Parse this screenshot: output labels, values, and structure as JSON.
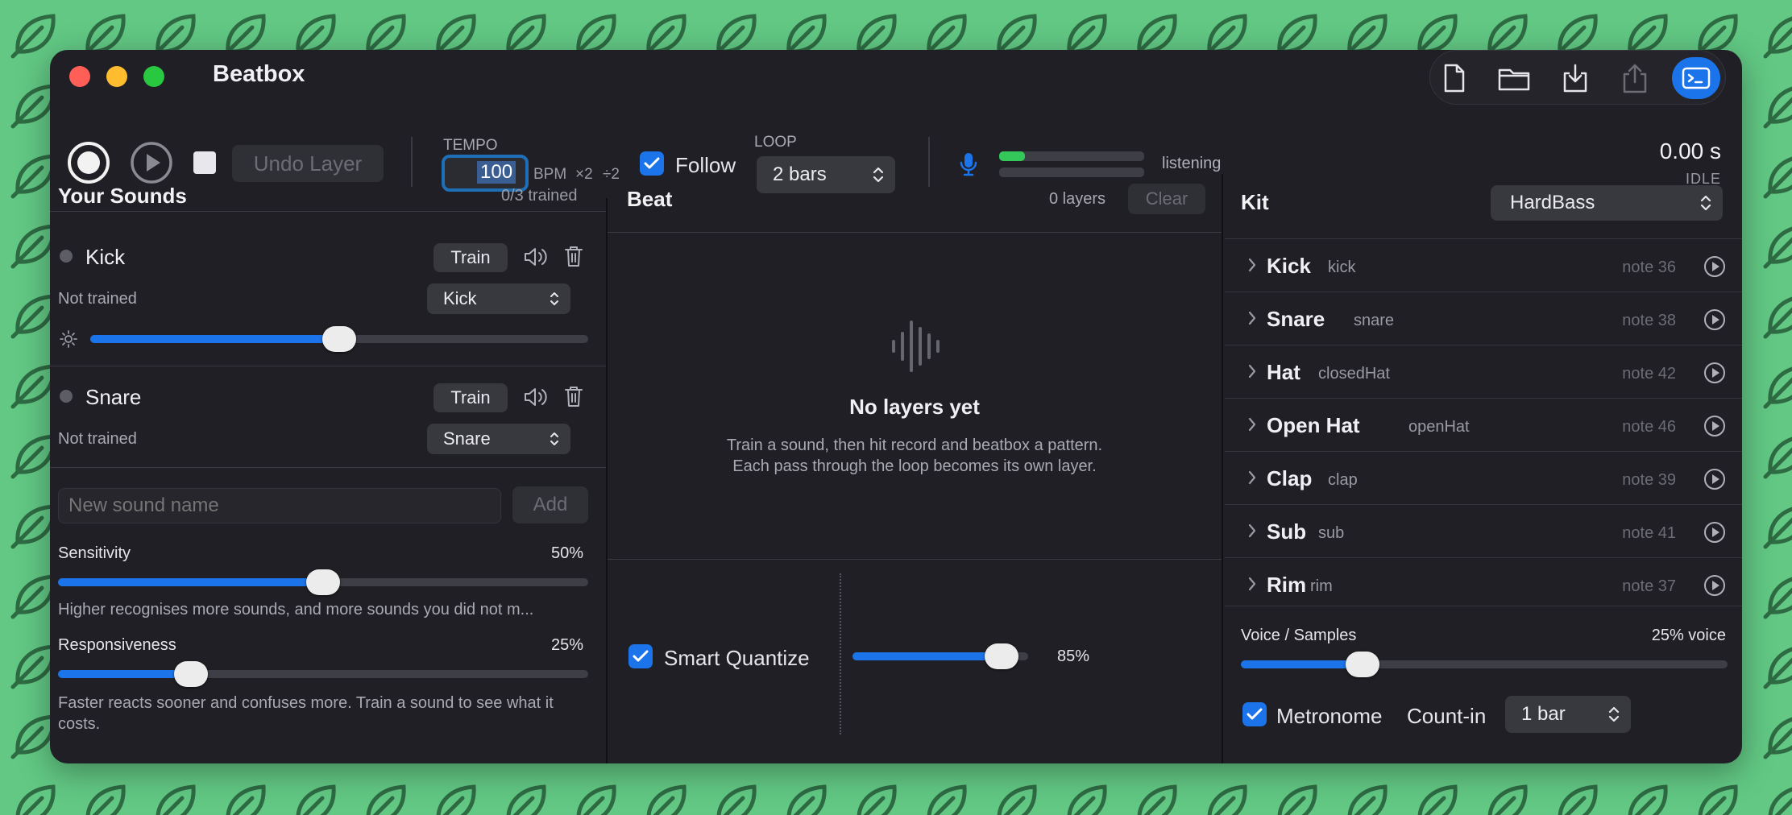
{
  "app": {
    "title": "Beatbox"
  },
  "transport": {
    "undo_label": "Undo Layer"
  },
  "tempo": {
    "label": "TEMPO",
    "bpm": "100",
    "unit": "BPM",
    "double": "×2",
    "half": "÷2",
    "trained": "0/3 trained"
  },
  "follow": {
    "label": "Follow"
  },
  "loop": {
    "label": "LOOP",
    "value": "2 bars"
  },
  "mic": {
    "level_percent": 18,
    "status": "listening"
  },
  "timer": {
    "value": "0.00 s",
    "state": "IDLE"
  },
  "sounds": {
    "header": "Your Sounds",
    "items": [
      {
        "name": "Kick",
        "train_label": "Train",
        "status": "Not trained",
        "mapping": "Kick",
        "threshold_percent": 50
      },
      {
        "name": "Snare",
        "train_label": "Train",
        "status": "Not trained",
        "mapping": "Snare"
      }
    ],
    "new_placeholder": "New sound name",
    "add_label": "Add",
    "sensitivity": {
      "label": "Sensitivity",
      "value": "50%",
      "percent": 50,
      "help": "Higher recognises more sounds, and more sounds you did not m..."
    },
    "responsiveness": {
      "label": "Responsiveness",
      "value": "25%",
      "percent": 25,
      "help": "Faster reacts sooner and confuses more. Train a sound to see what it costs."
    }
  },
  "beat": {
    "header": "Beat",
    "count": "0 layers",
    "clear_label": "Clear",
    "empty_title": "No layers yet",
    "empty_line1": "Train a sound, then hit record and beatbox a pattern.",
    "empty_line2": "Each pass through the loop becomes its own layer.",
    "quantize": {
      "label": "Smart Quantize",
      "value": "85%",
      "percent": 85
    }
  },
  "kit": {
    "header": "Kit",
    "preset": "HardBass",
    "items": [
      {
        "name": "Kick",
        "type": "kick",
        "note": "note 36"
      },
      {
        "name": "Snare",
        "type": "snare",
        "note": "note 38"
      },
      {
        "name": "Hat",
        "type": "closedHat",
        "note": "note 42"
      },
      {
        "name": "Open Hat",
        "type": "openHat",
        "note": "note 46"
      },
      {
        "name": "Clap",
        "type": "clap",
        "note": "note 39"
      },
      {
        "name": "Sub",
        "type": "sub",
        "note": "note 41"
      },
      {
        "name": "Rim",
        "type": "rim",
        "note": "note 37"
      }
    ],
    "voice": {
      "label": "Voice / Samples",
      "value": "25% voice",
      "percent": 25
    },
    "metronome": {
      "label": "Metronome"
    },
    "countin": {
      "label": "Count-in",
      "value": "1 bar"
    }
  },
  "colors": {
    "accent": "#1b74ea",
    "window": "#1f1f25",
    "meter": "#34c759",
    "close": "#ff5f57",
    "minimize": "#febc2e",
    "zoom": "#28c840"
  }
}
